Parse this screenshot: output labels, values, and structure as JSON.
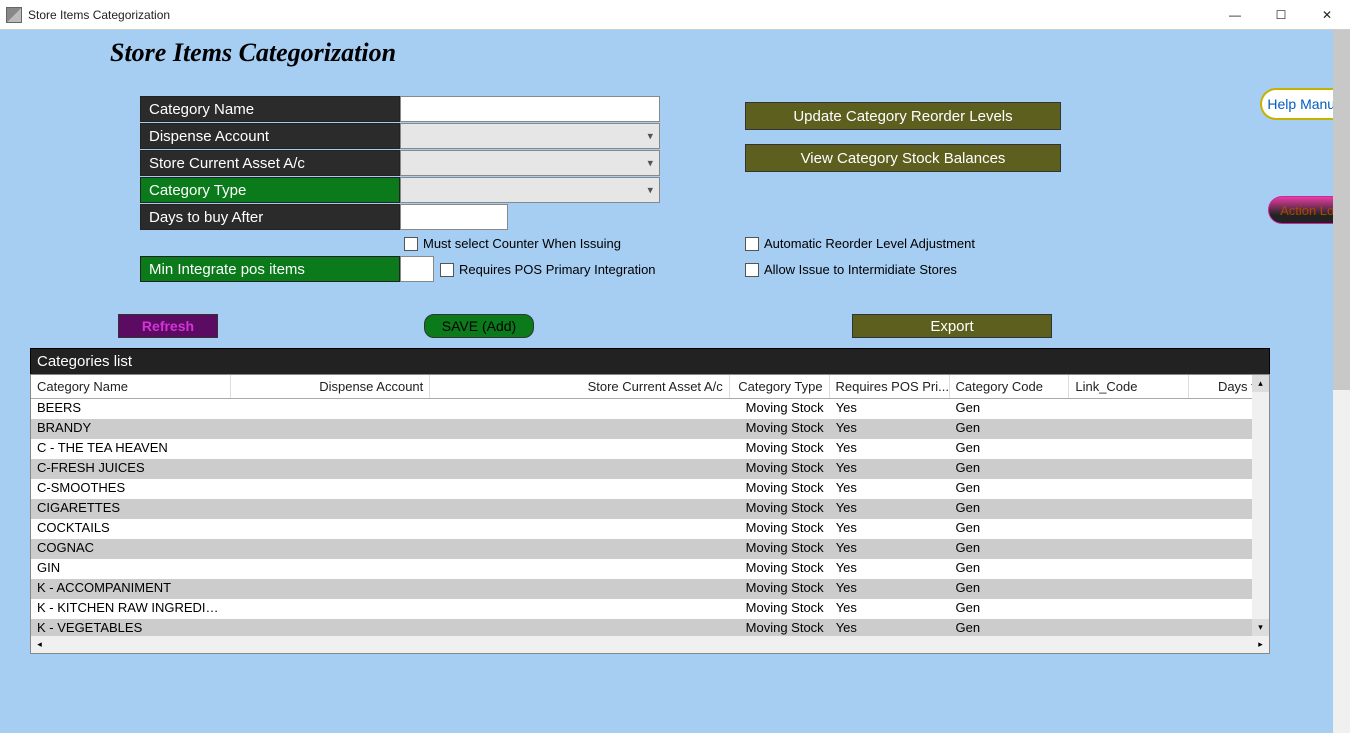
{
  "window": {
    "title": "Store Items Categorization"
  },
  "page_heading": "Store Items Categorization",
  "labels": {
    "category_name": "Category Name",
    "dispense_account": "Dispense Account",
    "store_current_asset": "Store Current Asset A/c",
    "category_type": "Category Type",
    "days_to_buy_after": "Days to buy After",
    "min_integrate_pos": "Min Integrate pos items",
    "must_select_counter": "Must select Counter When Issuing",
    "requires_pos_primary": "Requires POS Primary  Integration",
    "auto_reorder": "Automatic Reorder Level Adjustment",
    "allow_intermediate": "Allow Issue to Intermidiate Stores"
  },
  "buttons": {
    "update_reorder": "Update Category Reorder Levels",
    "view_balances": "View Category Stock Balances",
    "refresh": "Refresh",
    "save": "SAVE (Add)",
    "export": "Export",
    "help_manual": "Help Manual",
    "action_logs": "Action Logs"
  },
  "grid": {
    "title": "Categories list",
    "headers": [
      "Category Name",
      "Dispense Account",
      "Store Current Asset A/c",
      "Category Type",
      "Requires POS Pri...",
      "Category Code",
      "Link_Code",
      "Days to"
    ],
    "rows": [
      {
        "name": "BEERS",
        "disp": "",
        "asset": "",
        "type": "Moving Stock",
        "req": "Yes",
        "code": "Gen",
        "link": "",
        "days": ""
      },
      {
        "name": "BRANDY",
        "disp": "",
        "asset": "",
        "type": "Moving Stock",
        "req": "Yes",
        "code": "Gen",
        "link": "",
        "days": ""
      },
      {
        "name": "C - THE TEA HEAVEN",
        "disp": "",
        "asset": "",
        "type": "Moving Stock",
        "req": "Yes",
        "code": "Gen",
        "link": "",
        "days": ""
      },
      {
        "name": "C-FRESH JUICES",
        "disp": "",
        "asset": "",
        "type": "Moving Stock",
        "req": "Yes",
        "code": "Gen",
        "link": "",
        "days": ""
      },
      {
        "name": "C-SMOOTHES",
        "disp": "",
        "asset": "",
        "type": "Moving Stock",
        "req": "Yes",
        "code": "Gen",
        "link": "",
        "days": ""
      },
      {
        "name": "CIGARETTES",
        "disp": "",
        "asset": "",
        "type": "Moving Stock",
        "req": "Yes",
        "code": "Gen",
        "link": "",
        "days": ""
      },
      {
        "name": "COCKTAILS",
        "disp": "",
        "asset": "",
        "type": "Moving Stock",
        "req": "Yes",
        "code": "Gen",
        "link": "",
        "days": ""
      },
      {
        "name": "COGNAC",
        "disp": "",
        "asset": "",
        "type": "Moving Stock",
        "req": "Yes",
        "code": "Gen",
        "link": "",
        "days": ""
      },
      {
        "name": "GIN",
        "disp": "",
        "asset": "",
        "type": "Moving Stock",
        "req": "Yes",
        "code": "Gen",
        "link": "",
        "days": ""
      },
      {
        "name": "K - ACCOMPANIMENT",
        "disp": "",
        "asset": "",
        "type": "Moving Stock",
        "req": "Yes",
        "code": "Gen",
        "link": "",
        "days": ""
      },
      {
        "name": "K - KITCHEN RAW INGREDIE...",
        "disp": "",
        "asset": "",
        "type": "Moving Stock",
        "req": "Yes",
        "code": "Gen",
        "link": "",
        "days": ""
      },
      {
        "name": "K - VEGETABLES",
        "disp": "",
        "asset": "",
        "type": "Moving Stock",
        "req": "Yes",
        "code": "Gen",
        "link": "",
        "days": ""
      }
    ]
  }
}
